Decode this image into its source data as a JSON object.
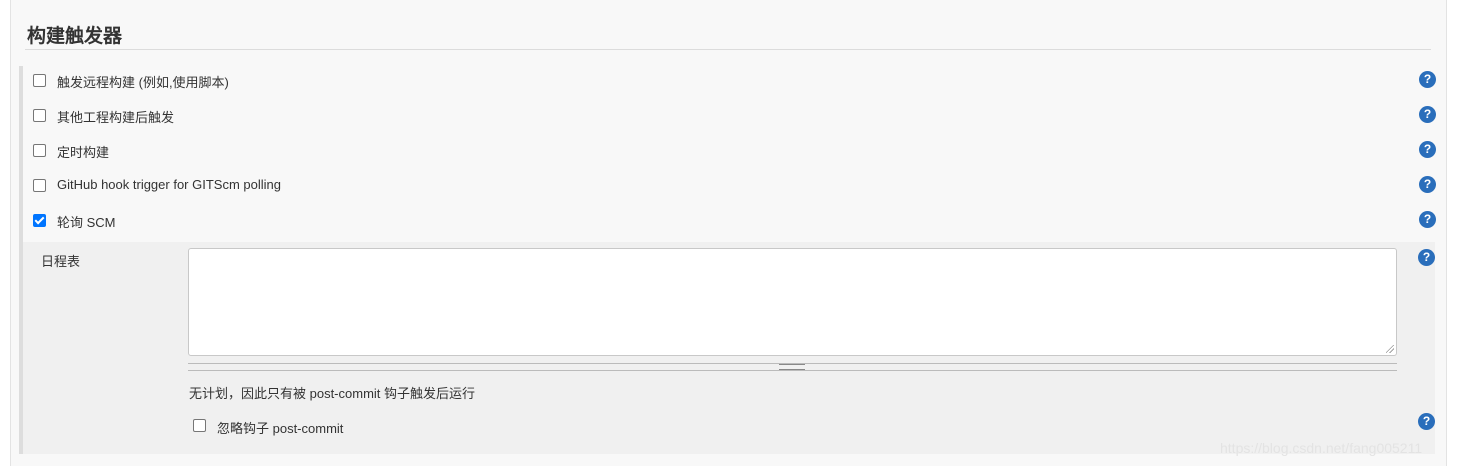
{
  "section": {
    "title": "构建触发器"
  },
  "triggers": [
    {
      "label": "触发远程构建 (例如,使用脚本)",
      "checked": false
    },
    {
      "label": "其他工程构建后触发",
      "checked": false
    },
    {
      "label": "定时构建",
      "checked": false
    },
    {
      "label": "GitHub hook trigger for GITScm polling",
      "checked": false
    },
    {
      "label": "轮询 SCM",
      "checked": true
    }
  ],
  "schedule": {
    "label": "日程表",
    "value": "",
    "note": "无计划，因此只有被 post-commit 钩子触发后运行",
    "ignore_hook_label": "忽略钩子 post-commit",
    "ignore_hook_checked": false
  },
  "help_glyph": "?",
  "help_icon_color": "#2a6ebb",
  "checkbox_checked_color": "#0075ff",
  "watermark": "https://blog.csdn.net/fang005211"
}
